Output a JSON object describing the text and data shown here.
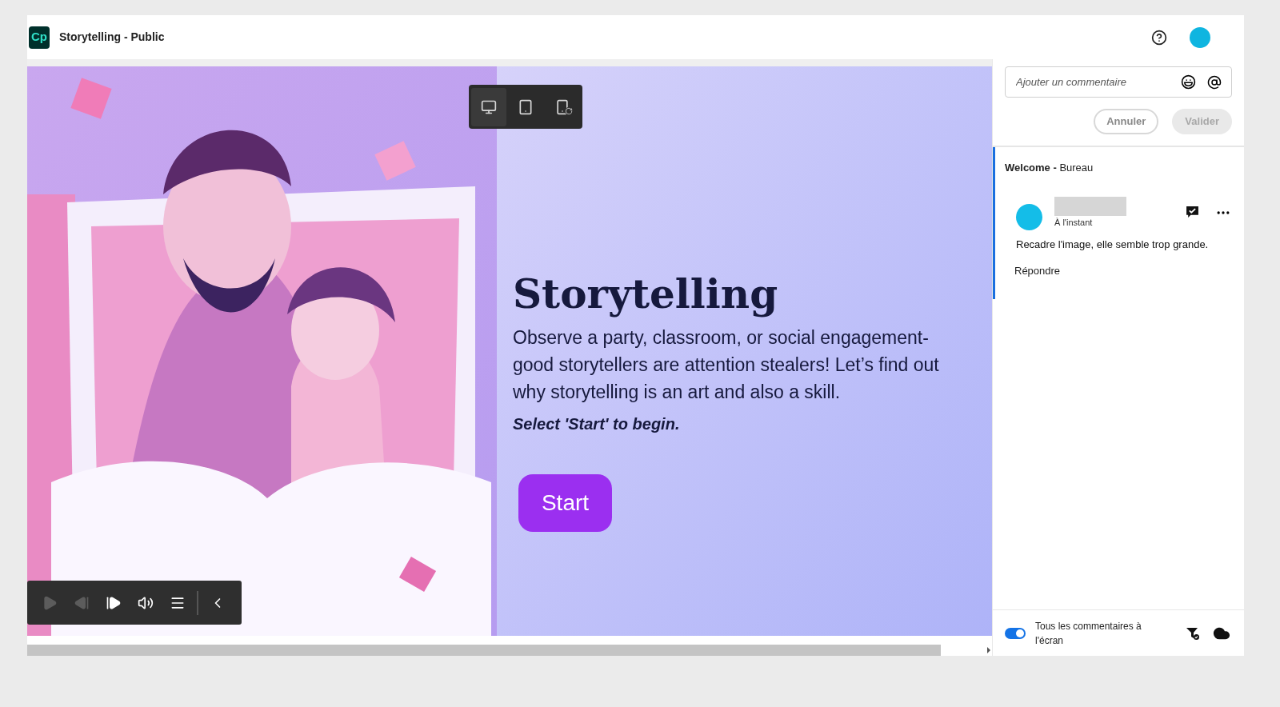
{
  "app": {
    "logo": "Cp",
    "title": "Storytelling - Public"
  },
  "device_toggle": [
    {
      "kind": "desktop",
      "selected": true
    },
    {
      "kind": "tablet",
      "selected": false
    },
    {
      "kind": "mobile_rotate",
      "selected": false
    }
  ],
  "slide": {
    "heading": "Storytelling",
    "body": "Observe a party, classroom, or social engagement- good storytellers are attention stealers! Let’s find out why storytelling is an art and also a skill.",
    "instruction": "Select 'Start' to begin.",
    "start_button": "Start"
  },
  "playbar": [
    {
      "kind": "play",
      "disabled": true
    },
    {
      "kind": "previous",
      "disabled": true
    },
    {
      "kind": "next",
      "disabled": false
    },
    {
      "kind": "volume",
      "disabled": false
    },
    {
      "kind": "menu",
      "disabled": false
    },
    {
      "kind": "collapse",
      "disabled": false
    }
  ],
  "comments_panel": {
    "input": {
      "placeholder": "Ajouter un commentaire"
    },
    "cancel": "Annuler",
    "submit": {
      "label": "Valider",
      "disabled": true
    },
    "thread": {
      "title": "**Welcome -** Bureau",
      "comment": {
        "time": "À l'instant",
        "text": "Recadre l'image, elle semble trop grande.",
        "reply": "Répondre"
      }
    },
    "footer": {
      "show_all": {
        "label": "Tous les commentaires à l'écran",
        "on": true
      }
    }
  }
}
